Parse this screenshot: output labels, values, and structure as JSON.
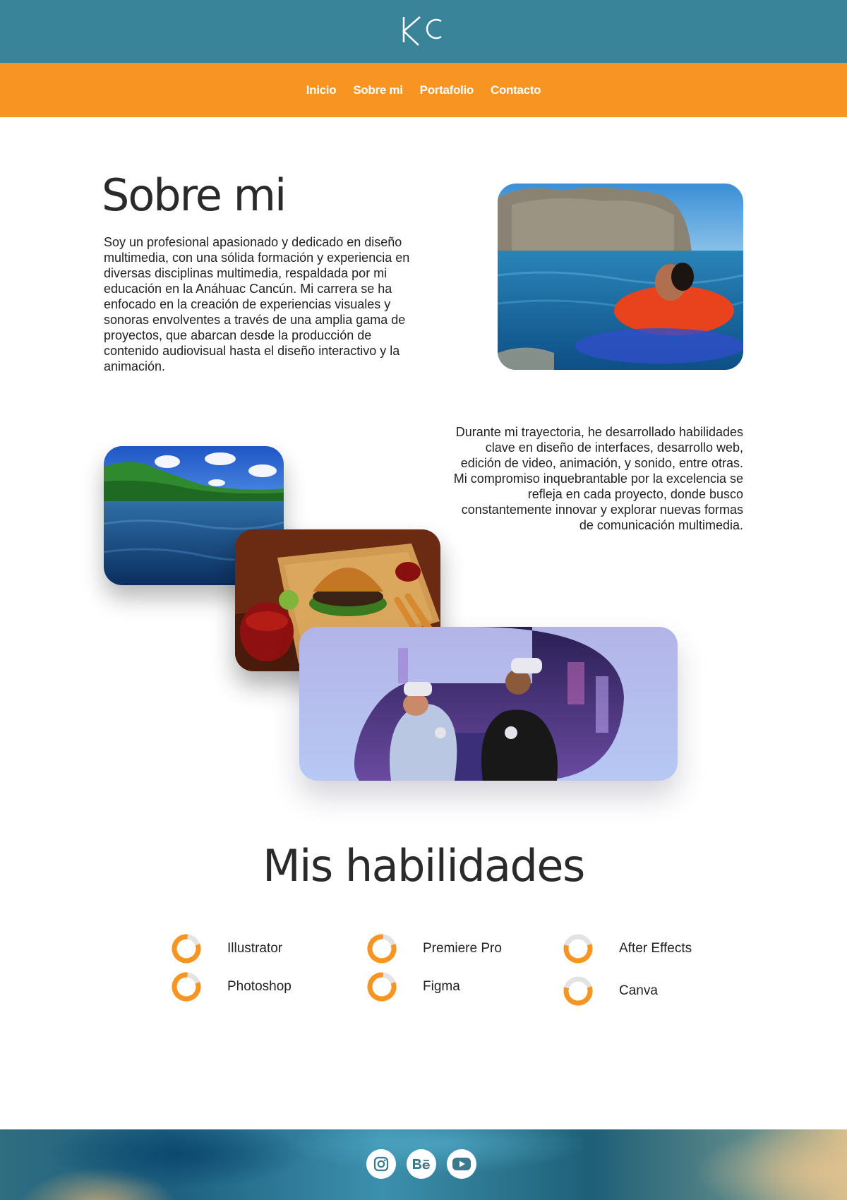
{
  "nav": {
    "items": [
      "Inicio",
      "Sobre mi",
      "Portafolio",
      "Contacto"
    ]
  },
  "about": {
    "title": "Sobre mi",
    "paragraph_1": "Soy un profesional apasionado y dedicado en diseño multimedia, con una sólida formación y experiencia en diversas disciplinas multimedia, respaldada por mi\neducación en la Anáhuac Cancún. Mi carrera se ha enfocado en la creación de experiencias visuales y\nsonoras envolventes a través de una amplia gama de proyectos, que abarcan desde la producción de contenido audiovisual hasta el diseño interactivo y la animación.",
    "paragraph_2": "Durante mi trayectoria, he desarrollado habilidades clave en diseño de interfaces, desarrollo web, edición de video, animación, y sonido, entre otras. Mi compromiso inquebrantable por la excelencia se refleja en cada proyecto, donde busco constantemente innovar y explorar nuevas formas de comunicación multimedia."
  },
  "skills": {
    "title": "Mis habilidades",
    "items": [
      {
        "name": "Illustrator",
        "level": 0.82
      },
      {
        "name": "Photoshop",
        "level": 0.82
      },
      {
        "name": "Premiere Pro",
        "level": 0.82
      },
      {
        "name": "Figma",
        "level": 0.82
      },
      {
        "name": "After Effects",
        "level": 0.6
      },
      {
        "name": "Canva",
        "level": 0.6
      }
    ]
  },
  "footer": {
    "social": [
      "instagram-icon",
      "behance-icon",
      "youtube-icon"
    ]
  },
  "colors": {
    "header": "#3a8499",
    "nav": "#f89422",
    "accent": "#f89422",
    "ring_track": "#e3e3e3"
  }
}
